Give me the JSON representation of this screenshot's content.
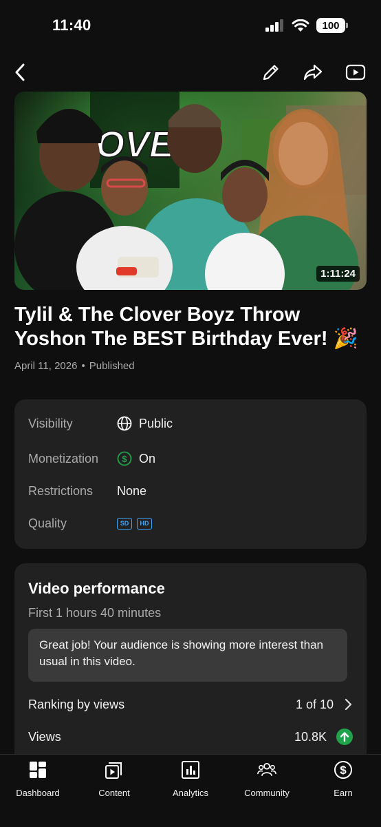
{
  "status_bar": {
    "time": "11:40",
    "battery": "100"
  },
  "video": {
    "title": "Tylil & The Clover Boyz Throw Yoshon The BEST Birthday Ever! 🎉",
    "duration": "1:11:24",
    "date": "April 11, 2026",
    "separator": "•",
    "status": "Published"
  },
  "details": {
    "visibility_label": "Visibility",
    "visibility_value": "Public",
    "monetization_label": "Monetization",
    "monetization_value": "On",
    "restrictions_label": "Restrictions",
    "restrictions_value": "None",
    "quality_label": "Quality",
    "quality_badges": [
      "SD",
      "HD"
    ]
  },
  "performance": {
    "title": "Video performance",
    "subtitle": "First 1 hours 40 minutes",
    "insight": "Great job! Your audience is showing more interest than usual in this video.",
    "ranking_label": "Ranking by views",
    "ranking_value": "1 of 10",
    "views_label": "Views",
    "views_value": "10.8K"
  },
  "tabs": [
    {
      "label": "Dashboard",
      "icon": "dashboard-icon"
    },
    {
      "label": "Content",
      "icon": "content-icon"
    },
    {
      "label": "Analytics",
      "icon": "analytics-icon"
    },
    {
      "label": "Community",
      "icon": "community-icon"
    },
    {
      "label": "Earn",
      "icon": "earn-icon"
    }
  ],
  "colors": {
    "background": "#0f0f0f",
    "card": "#212121",
    "muted_text": "#aaaaaa",
    "green": "#1fa34a",
    "blue": "#3ea6ff"
  }
}
